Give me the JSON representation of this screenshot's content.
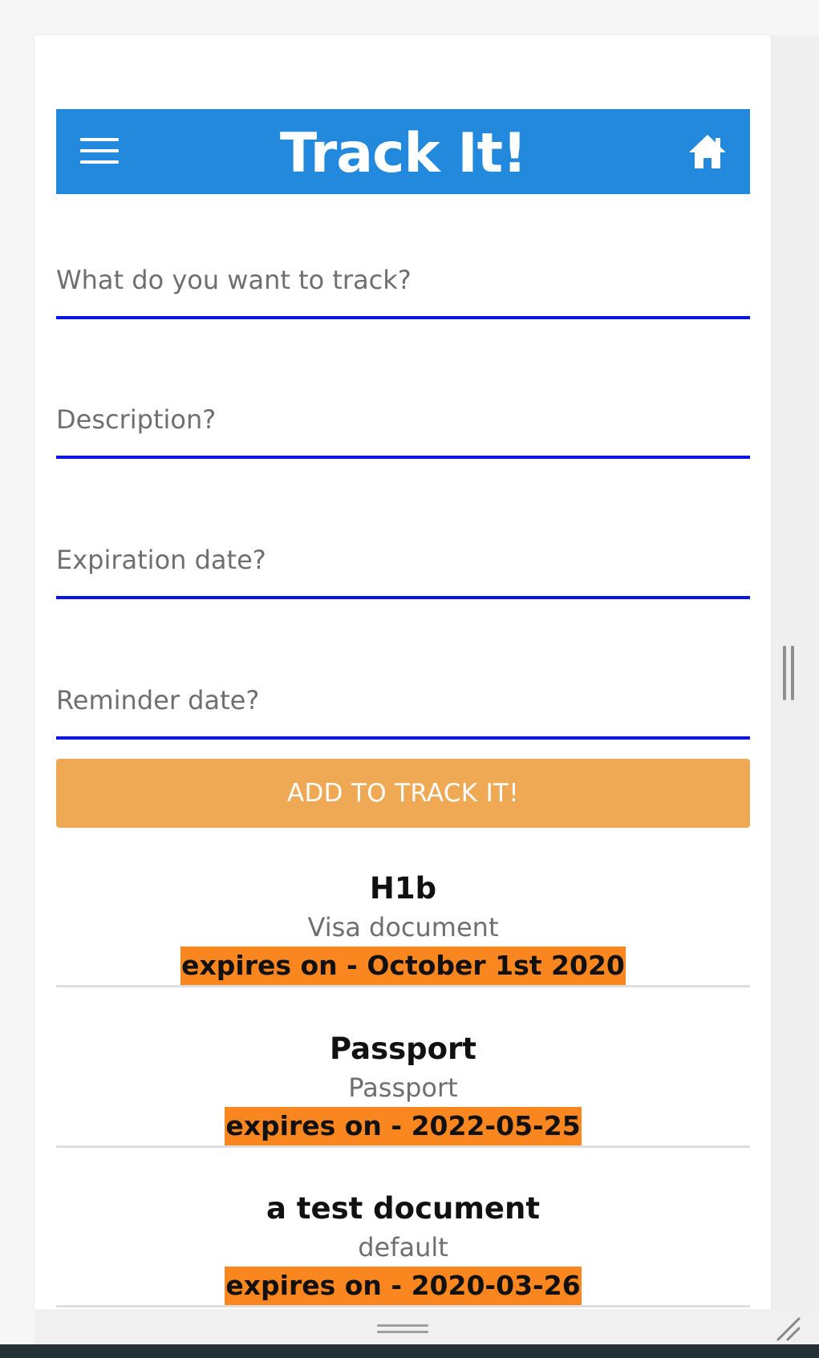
{
  "header": {
    "title": "Track It!",
    "menu_icon": "hamburger-menu-icon",
    "home_icon": "home-icon",
    "background_color": "#2289dc"
  },
  "form": {
    "fields": [
      {
        "name": "item",
        "placeholder": "What do you want to track?",
        "value": ""
      },
      {
        "name": "description",
        "placeholder": "Description?",
        "value": ""
      },
      {
        "name": "expiration",
        "placeholder": "Expiration date?",
        "value": ""
      },
      {
        "name": "reminder",
        "placeholder": "Reminder date?",
        "value": ""
      }
    ],
    "underline_color": "#0a14e6",
    "submit_label": "ADD TO TRACK IT!",
    "submit_color": "#efa955"
  },
  "items": [
    {
      "title": "H1b",
      "description": "Visa document",
      "expiry": "expires on - October 1st 2020"
    },
    {
      "title": "Passport",
      "description": "Passport",
      "expiry": "expires on - 2022-05-25"
    },
    {
      "title": "a test document",
      "description": "default",
      "expiry": "expires on - 2020-03-26"
    }
  ],
  "expiry_highlight_color": "#fa8620"
}
